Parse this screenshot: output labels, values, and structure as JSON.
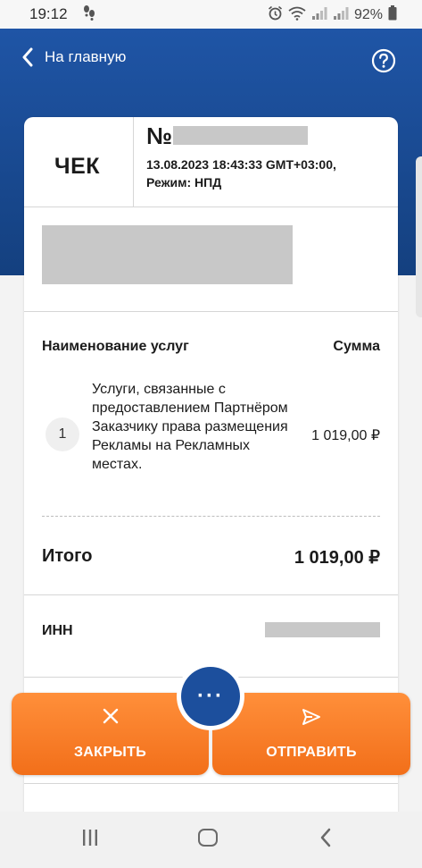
{
  "status_bar": {
    "time": "19:12",
    "battery": "92%"
  },
  "header": {
    "back_label": "На главную"
  },
  "receipt": {
    "title": "ЧЕК",
    "number_prefix": "№",
    "datetime": "13.08.2023 18:43:33 GMT+03:00,",
    "mode": "Режим: НПД"
  },
  "table": {
    "col_name": "Наименование услуг",
    "col_sum": "Сумма",
    "items": [
      {
        "index": "1",
        "name": "Услуги, связанные с предоставлением Партнёром Заказчику права размещения Рекламы на Рекламных местах.",
        "price": "1 019,00 ₽"
      }
    ]
  },
  "total": {
    "label": "Итого",
    "value": "1 019,00 ₽"
  },
  "inn": {
    "label": "ИНН"
  },
  "actions": {
    "close_label": "ЗАКРЫТЬ",
    "send_label": "ОТПРАВИТЬ",
    "more_label": "···"
  },
  "colors": {
    "header_blue": "#1c4f9d",
    "button_orange": "#f57d26"
  }
}
